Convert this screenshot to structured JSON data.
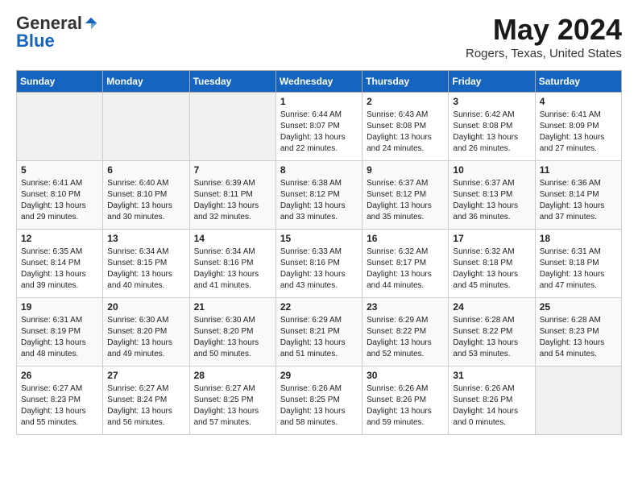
{
  "logo": {
    "general": "General",
    "blue": "Blue"
  },
  "title": "May 2024",
  "location": "Rogers, Texas, United States",
  "days_header": [
    "Sunday",
    "Monday",
    "Tuesday",
    "Wednesday",
    "Thursday",
    "Friday",
    "Saturday"
  ],
  "weeks": [
    [
      {
        "day": "",
        "info": ""
      },
      {
        "day": "",
        "info": ""
      },
      {
        "day": "",
        "info": ""
      },
      {
        "day": "1",
        "info": "Sunrise: 6:44 AM\nSunset: 8:07 PM\nDaylight: 13 hours\nand 22 minutes."
      },
      {
        "day": "2",
        "info": "Sunrise: 6:43 AM\nSunset: 8:08 PM\nDaylight: 13 hours\nand 24 minutes."
      },
      {
        "day": "3",
        "info": "Sunrise: 6:42 AM\nSunset: 8:08 PM\nDaylight: 13 hours\nand 26 minutes."
      },
      {
        "day": "4",
        "info": "Sunrise: 6:41 AM\nSunset: 8:09 PM\nDaylight: 13 hours\nand 27 minutes."
      }
    ],
    [
      {
        "day": "5",
        "info": "Sunrise: 6:41 AM\nSunset: 8:10 PM\nDaylight: 13 hours\nand 29 minutes."
      },
      {
        "day": "6",
        "info": "Sunrise: 6:40 AM\nSunset: 8:10 PM\nDaylight: 13 hours\nand 30 minutes."
      },
      {
        "day": "7",
        "info": "Sunrise: 6:39 AM\nSunset: 8:11 PM\nDaylight: 13 hours\nand 32 minutes."
      },
      {
        "day": "8",
        "info": "Sunrise: 6:38 AM\nSunset: 8:12 PM\nDaylight: 13 hours\nand 33 minutes."
      },
      {
        "day": "9",
        "info": "Sunrise: 6:37 AM\nSunset: 8:12 PM\nDaylight: 13 hours\nand 35 minutes."
      },
      {
        "day": "10",
        "info": "Sunrise: 6:37 AM\nSunset: 8:13 PM\nDaylight: 13 hours\nand 36 minutes."
      },
      {
        "day": "11",
        "info": "Sunrise: 6:36 AM\nSunset: 8:14 PM\nDaylight: 13 hours\nand 37 minutes."
      }
    ],
    [
      {
        "day": "12",
        "info": "Sunrise: 6:35 AM\nSunset: 8:14 PM\nDaylight: 13 hours\nand 39 minutes."
      },
      {
        "day": "13",
        "info": "Sunrise: 6:34 AM\nSunset: 8:15 PM\nDaylight: 13 hours\nand 40 minutes."
      },
      {
        "day": "14",
        "info": "Sunrise: 6:34 AM\nSunset: 8:16 PM\nDaylight: 13 hours\nand 41 minutes."
      },
      {
        "day": "15",
        "info": "Sunrise: 6:33 AM\nSunset: 8:16 PM\nDaylight: 13 hours\nand 43 minutes."
      },
      {
        "day": "16",
        "info": "Sunrise: 6:32 AM\nSunset: 8:17 PM\nDaylight: 13 hours\nand 44 minutes."
      },
      {
        "day": "17",
        "info": "Sunrise: 6:32 AM\nSunset: 8:18 PM\nDaylight: 13 hours\nand 45 minutes."
      },
      {
        "day": "18",
        "info": "Sunrise: 6:31 AM\nSunset: 8:18 PM\nDaylight: 13 hours\nand 47 minutes."
      }
    ],
    [
      {
        "day": "19",
        "info": "Sunrise: 6:31 AM\nSunset: 8:19 PM\nDaylight: 13 hours\nand 48 minutes."
      },
      {
        "day": "20",
        "info": "Sunrise: 6:30 AM\nSunset: 8:20 PM\nDaylight: 13 hours\nand 49 minutes."
      },
      {
        "day": "21",
        "info": "Sunrise: 6:30 AM\nSunset: 8:20 PM\nDaylight: 13 hours\nand 50 minutes."
      },
      {
        "day": "22",
        "info": "Sunrise: 6:29 AM\nSunset: 8:21 PM\nDaylight: 13 hours\nand 51 minutes."
      },
      {
        "day": "23",
        "info": "Sunrise: 6:29 AM\nSunset: 8:22 PM\nDaylight: 13 hours\nand 52 minutes."
      },
      {
        "day": "24",
        "info": "Sunrise: 6:28 AM\nSunset: 8:22 PM\nDaylight: 13 hours\nand 53 minutes."
      },
      {
        "day": "25",
        "info": "Sunrise: 6:28 AM\nSunset: 8:23 PM\nDaylight: 13 hours\nand 54 minutes."
      }
    ],
    [
      {
        "day": "26",
        "info": "Sunrise: 6:27 AM\nSunset: 8:23 PM\nDaylight: 13 hours\nand 55 minutes."
      },
      {
        "day": "27",
        "info": "Sunrise: 6:27 AM\nSunset: 8:24 PM\nDaylight: 13 hours\nand 56 minutes."
      },
      {
        "day": "28",
        "info": "Sunrise: 6:27 AM\nSunset: 8:25 PM\nDaylight: 13 hours\nand 57 minutes."
      },
      {
        "day": "29",
        "info": "Sunrise: 6:26 AM\nSunset: 8:25 PM\nDaylight: 13 hours\nand 58 minutes."
      },
      {
        "day": "30",
        "info": "Sunrise: 6:26 AM\nSunset: 8:26 PM\nDaylight: 13 hours\nand 59 minutes."
      },
      {
        "day": "31",
        "info": "Sunrise: 6:26 AM\nSunset: 8:26 PM\nDaylight: 14 hours\nand 0 minutes."
      },
      {
        "day": "",
        "info": ""
      }
    ]
  ]
}
